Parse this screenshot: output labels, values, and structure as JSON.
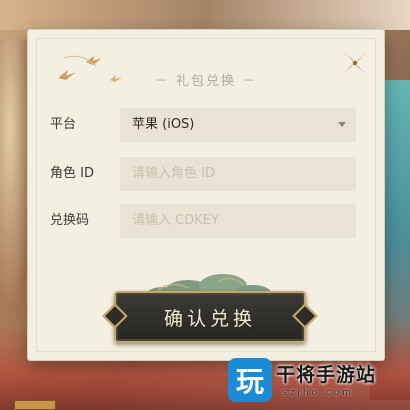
{
  "dialog": {
    "title": "－ 礼包兑换 －",
    "confirm_label": "确认兑换"
  },
  "form": {
    "platform": {
      "label": "平台",
      "value": "苹果 (iOS)"
    },
    "role_id": {
      "label": "角色 ID",
      "placeholder": "请输入角色 ID",
      "value": ""
    },
    "code": {
      "label": "兑换码",
      "placeholder": "请输入 CDKEY",
      "value": ""
    }
  },
  "watermark": {
    "logo_text": "玩",
    "name": "干将手游站",
    "domain": "szjho.com"
  },
  "colors": {
    "panel_bg": "#f3efe2",
    "field_bg": "#e9e3d3",
    "button_bg": "#2d2c28",
    "button_border": "#c7a86a",
    "accent_gold": "#b8945a"
  },
  "icons": {
    "close": "close-icon",
    "select_arrow": "chevron-down-icon",
    "swallows": "swallow-decoration-icon",
    "clouds": "cloud-decoration-icon"
  }
}
